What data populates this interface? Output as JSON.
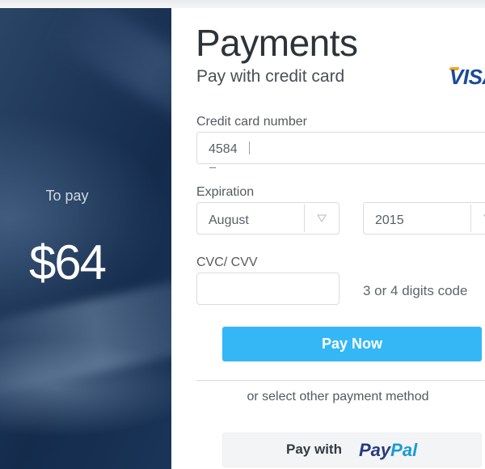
{
  "summary": {
    "to_pay_label": "To pay",
    "amount": "$64"
  },
  "header": {
    "title": "Payments",
    "subtitle": "Pay with credit card",
    "card_brand": "VISA"
  },
  "form": {
    "card_number": {
      "label": "Credit card number",
      "value": "4584"
    },
    "expiration": {
      "label": "Expiration",
      "month": "August",
      "year": "2015"
    },
    "cvc": {
      "label": "CVC/ CVV",
      "value": "",
      "hint": "3 or 4 digits code"
    }
  },
  "actions": {
    "pay_now_label": "Pay Now",
    "alternate_label": "or select other payment method",
    "paypal_prefix": "Pay with",
    "paypal_logo_part1": "Pay",
    "paypal_logo_part2": "Pal"
  },
  "colors": {
    "primary_button": "#35b7f6",
    "panel_dark": "#1b3355",
    "visa_blue": "#1a4a9c",
    "paypal_dark": "#253b80",
    "paypal_light": "#179bd7"
  },
  "icons": {
    "select_chevron": "chevron-down-icon"
  }
}
